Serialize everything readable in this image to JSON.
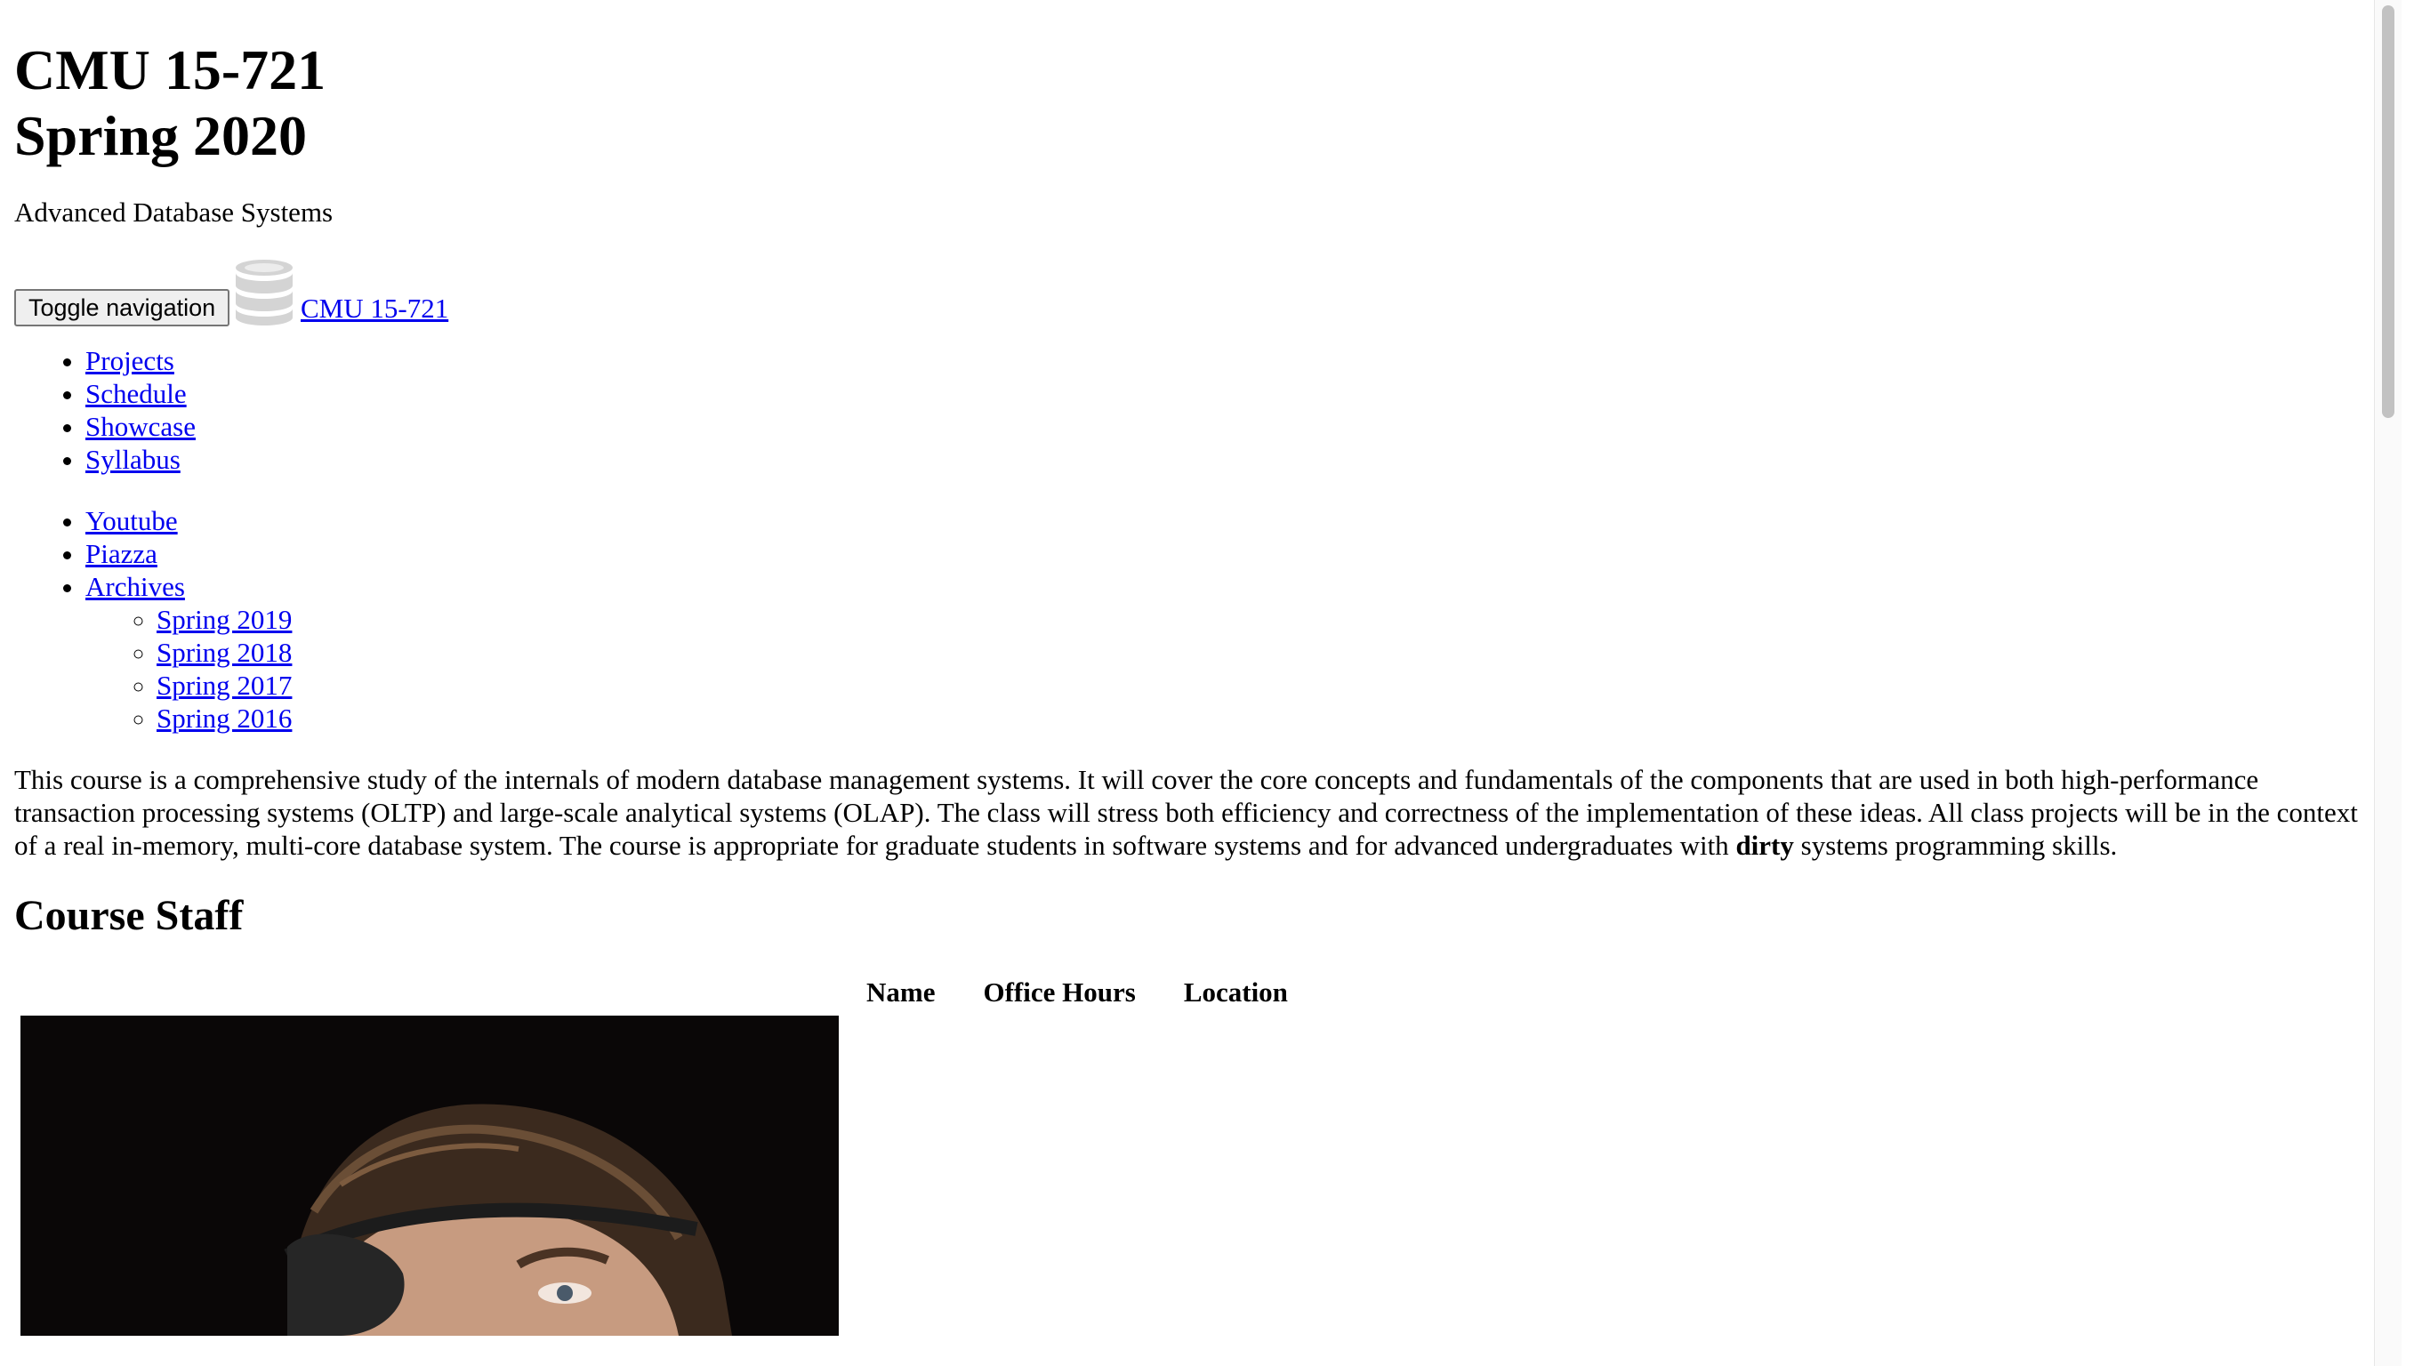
{
  "site": {
    "title_line1": "CMU 15-721",
    "title_line2": "Spring 2020",
    "subtitle": "Advanced Database Systems"
  },
  "navbar": {
    "toggle_label": "Toggle navigation",
    "brand_label": "CMU 15-721",
    "brand_icon": "database-icon"
  },
  "nav_primary": [
    {
      "label": "Projects"
    },
    {
      "label": "Schedule"
    },
    {
      "label": "Showcase"
    },
    {
      "label": "Syllabus"
    }
  ],
  "nav_secondary": [
    {
      "label": "Youtube"
    },
    {
      "label": "Piazza"
    },
    {
      "label": "Archives"
    }
  ],
  "archives": [
    {
      "label": "Spring 2019"
    },
    {
      "label": "Spring 2018"
    },
    {
      "label": "Spring 2017"
    },
    {
      "label": "Spring 2016"
    }
  ],
  "description": {
    "before_bold": "This course is a comprehensive study of the internals of modern database management systems. It will cover the core concepts and fundamentals of the components that are used in both high-performance transaction processing systems (OLTP) and large-scale analytical systems (OLAP). The class will stress both efficiency and correctness of the implementation of these ideas. All class projects will be in the context of a real in-memory, multi-core database system. The course is appropriate for graduate students in software systems and for advanced undergraduates with ",
    "bold": "dirty",
    "after_bold": " systems programming skills."
  },
  "staff": {
    "heading": "Course Staff",
    "columns": [
      "Name",
      "Office Hours",
      "Location"
    ]
  },
  "colors": {
    "link": "#0000ee",
    "photo_background": "#0a0707",
    "icon_gray": "#cfcfcf"
  }
}
